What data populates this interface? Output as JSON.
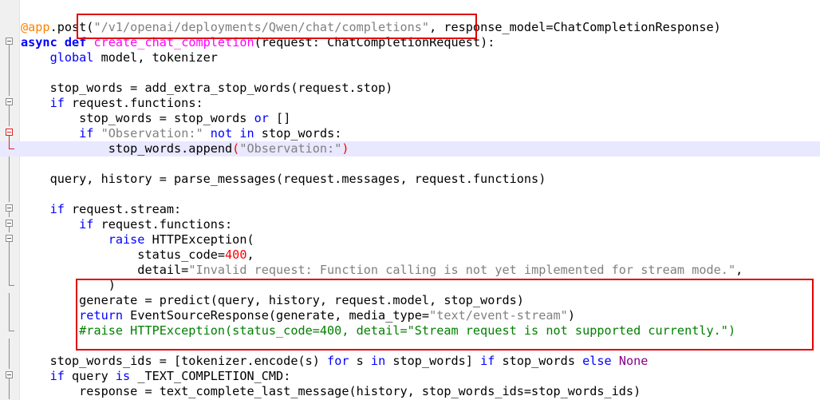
{
  "editor": {
    "lines": [
      {
        "tokens": [
          [
            "dec",
            "@app"
          ],
          [
            "",
            "."
          ],
          [
            "",
            "post("
          ],
          [
            "str",
            "\"/v1/openai/deployments/Qwen/chat/completions\""
          ],
          [
            "",
            ", response_model=ChatCompletionResponse)"
          ]
        ],
        "fold": "none"
      },
      {
        "tokens": [
          [
            "kwb",
            "async"
          ],
          [
            "",
            " "
          ],
          [
            "kwb",
            "def"
          ],
          [
            "",
            " "
          ],
          [
            "fn",
            "create_chat_completion"
          ],
          [
            "",
            "(request: ChatCompletionRequest):"
          ]
        ],
        "fold": "box"
      },
      {
        "tokens": [
          [
            "",
            "    "
          ],
          [
            "kw",
            "global"
          ],
          [
            "",
            " model, tokenizer"
          ]
        ],
        "fold": "vline"
      },
      {
        "tokens": [],
        "fold": "vline"
      },
      {
        "tokens": [
          [
            "",
            "    stop_words = add_extra_stop_words(request.stop)"
          ]
        ],
        "fold": "vline"
      },
      {
        "tokens": [
          [
            "",
            "    "
          ],
          [
            "kw",
            "if"
          ],
          [
            "",
            " request.functions:"
          ]
        ],
        "fold": "box"
      },
      {
        "tokens": [
          [
            "",
            "        stop_words = stop_words "
          ],
          [
            "kw",
            "or"
          ],
          [
            "",
            " []"
          ]
        ],
        "fold": "vline"
      },
      {
        "tokens": [
          [
            "",
            "        "
          ],
          [
            "kw",
            "if"
          ],
          [
            "",
            " "
          ],
          [
            "str",
            "\"Observation:\""
          ],
          [
            "",
            " "
          ],
          [
            "kw",
            "not in"
          ],
          [
            "",
            " stop_words:"
          ]
        ],
        "fold": "boxred"
      },
      {
        "tokens": [
          [
            "",
            "            stop_words.append"
          ],
          [
            "red",
            "("
          ],
          [
            "str",
            "\"Observation:\""
          ],
          [
            "red",
            ")"
          ]
        ],
        "fold": "elbowred",
        "current": true
      },
      {
        "tokens": [],
        "fold": "vline"
      },
      {
        "tokens": [
          [
            "",
            "    query, history = parse_messages(request.messages, request.functions)"
          ]
        ],
        "fold": "vline"
      },
      {
        "tokens": [],
        "fold": "vline"
      },
      {
        "tokens": [
          [
            "",
            "    "
          ],
          [
            "kw",
            "if"
          ],
          [
            "",
            " request.stream:"
          ]
        ],
        "fold": "box"
      },
      {
        "tokens": [
          [
            "",
            "        "
          ],
          [
            "kw",
            "if"
          ],
          [
            "",
            " request.functions:"
          ]
        ],
        "fold": "box"
      },
      {
        "tokens": [
          [
            "",
            "            "
          ],
          [
            "kw",
            "raise"
          ],
          [
            "",
            " HTTPException("
          ]
        ],
        "fold": "box"
      },
      {
        "tokens": [
          [
            "",
            "                status_code="
          ],
          [
            "num",
            "400"
          ],
          [
            "",
            ","
          ]
        ],
        "fold": "vline"
      },
      {
        "tokens": [
          [
            "",
            "                detail="
          ],
          [
            "str",
            "\"Invalid request: Function calling is not yet implemented for stream mode.\""
          ],
          [
            "",
            ","
          ]
        ],
        "fold": "vline"
      },
      {
        "tokens": [
          [
            "",
            "            )"
          ]
        ],
        "fold": "elbow"
      },
      {
        "tokens": [
          [
            "",
            "        generate = predict(query, history, request.model, stop_words)"
          ]
        ],
        "fold": "vline"
      },
      {
        "tokens": [
          [
            "",
            "        "
          ],
          [
            "kw",
            "return"
          ],
          [
            "",
            " EventSourceResponse(generate, media_type="
          ],
          [
            "str",
            "\"text/event-stream\""
          ],
          [
            "",
            ")"
          ]
        ],
        "fold": "vline"
      },
      {
        "tokens": [
          [
            "",
            "        "
          ],
          [
            "cm",
            "#raise HTTPException(status_code=400, detail=\"Stream request is not supported currently.\")"
          ]
        ],
        "fold": "elbow"
      },
      {
        "tokens": [],
        "fold": "vline"
      },
      {
        "tokens": [
          [
            "",
            "    stop_words_ids = [tokenizer.encode(s) "
          ],
          [
            "kw",
            "for"
          ],
          [
            "",
            " s "
          ],
          [
            "kw",
            "in"
          ],
          [
            "",
            " stop_words] "
          ],
          [
            "kw",
            "if"
          ],
          [
            "",
            " stop_words "
          ],
          [
            "kw",
            "else"
          ],
          [
            "",
            " "
          ],
          [
            "none",
            "None"
          ]
        ],
        "fold": "vline"
      },
      {
        "tokens": [
          [
            "",
            "    "
          ],
          [
            "kw",
            "if"
          ],
          [
            "",
            " query "
          ],
          [
            "kw",
            "is"
          ],
          [
            "",
            " _TEXT_COMPLETION_CMD:"
          ]
        ],
        "fold": "box"
      },
      {
        "tokens": [
          [
            "",
            "        response = text_complete_last_message(history, stop_words_ids=stop_words_ids)"
          ]
        ],
        "fold": "vline"
      }
    ]
  }
}
